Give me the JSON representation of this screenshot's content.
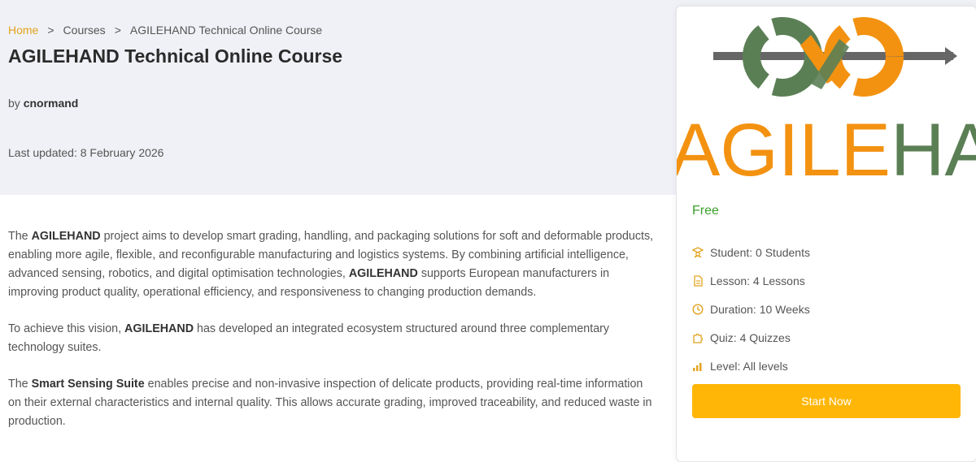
{
  "breadcrumb": {
    "home": "Home",
    "courses": "Courses",
    "current": "AGILEHAND Technical Online Course",
    "separator": ">"
  },
  "course": {
    "title": "AGILEHAND Technical Online Course",
    "by_prefix": "by",
    "author": "cnormand",
    "last_updated": "Last updated: 8 February 2026"
  },
  "content": {
    "p1": {
      "t1": "The ",
      "b1": "AGILEHAND",
      "t2": " project aims to develop smart grading, handling, and packaging solutions for soft and deformable products, enabling more agile, flexible, and reconfigurable manufacturing and logistics systems. By combining artificial intelligence, advanced sensing, robotics, and digital optimisation technologies, ",
      "b2": "AGILEHAND",
      "t3": " supports European manufacturers in improving product quality, operational efficiency, and responsiveness to changing production demands."
    },
    "p2": {
      "t1": "To achieve this vision, ",
      "b1": "AGILEHAND",
      "t2": " has developed an integrated ecosystem structured around three complementary technology suites."
    },
    "p3": {
      "t1": "The ",
      "b1": "Smart Sensing Suite",
      "t2": " enables precise and non-invasive inspection of delicate products, providing real-time information on their external characteristics and internal quality. This allows accurate grading, improved traceability, and reduced waste in production."
    }
  },
  "sidebar": {
    "logo_text": "AGILEHAND",
    "price": "Free",
    "meta": [
      {
        "icon": "student-icon",
        "label": "Student: 0 Students"
      },
      {
        "icon": "lesson-icon",
        "label": "Lesson: 4 Lessons"
      },
      {
        "icon": "clock-icon",
        "label": "Duration: 10 Weeks"
      },
      {
        "icon": "puzzle-icon",
        "label": "Quiz: 4 Quizzes"
      },
      {
        "icon": "level-icon",
        "label": "Level: All levels"
      }
    ],
    "start_button": "Start Now"
  },
  "colors": {
    "accent": "#ffb606",
    "home_link": "#e2a31d",
    "price": "#3ca02c",
    "logo_orange": "#f39211",
    "logo_green": "#5b7f55",
    "hero_bg": "#f0f1f6"
  }
}
